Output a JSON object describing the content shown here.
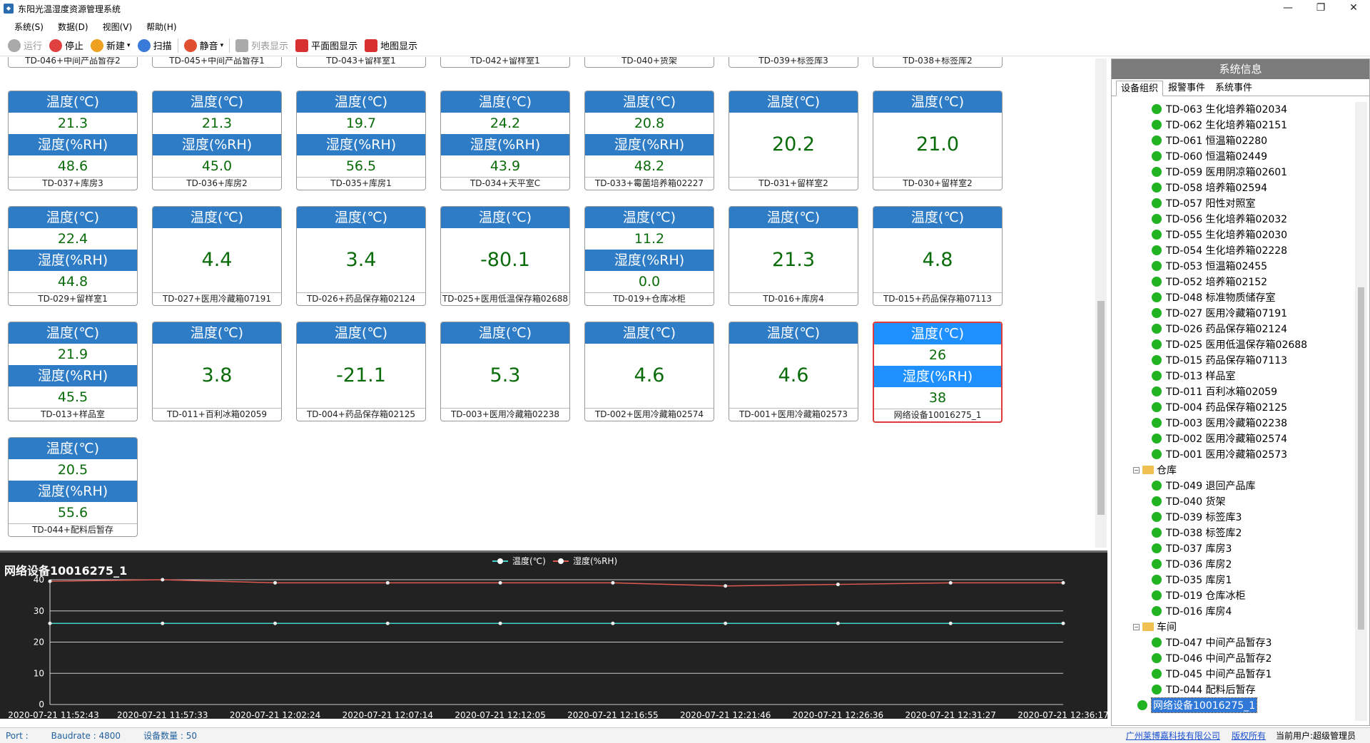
{
  "window": {
    "title": "东阳光温湿度资源管理系统",
    "min": "—",
    "max": "❐",
    "close": "✕"
  },
  "menu": [
    "系统(S)",
    "数据(D)",
    "视图(V)",
    "帮助(H)"
  ],
  "toolbar": [
    {
      "label": "运行",
      "icon": "play-icon",
      "color": "#aaaaaa",
      "disabled": true
    },
    {
      "label": "停止",
      "icon": "stop-icon",
      "color": "#e04040",
      "disabled": false
    },
    {
      "label": "新建",
      "icon": "add-icon",
      "color": "#f0a020",
      "disabled": false
    },
    {
      "label": "扫描",
      "icon": "scan-icon",
      "color": "#3a7ad8",
      "disabled": false
    },
    {
      "label": "静音",
      "icon": "alarm-icon",
      "color": "#e05030",
      "disabled": false
    },
    {
      "label": "列表显示",
      "icon": "list-icon",
      "color": "#aaaaaa",
      "disabled": true
    },
    {
      "label": "平面图显示",
      "icon": "pin-icon",
      "color": "#d83030",
      "disabled": false
    },
    {
      "label": "地图显示",
      "icon": "map-pin-icon",
      "color": "#d83030",
      "disabled": false
    }
  ],
  "cards": {
    "labels": {
      "temp": "温度(℃)",
      "hum": "湿度(%RH)"
    },
    "row0": [
      "TD-046+中间产品暂存2",
      "TD-045+中间产品暂存1",
      "TD-043+留样室1",
      "TD-042+留样室1",
      "TD-040+货架",
      "TD-039+标签库3",
      "TD-038+标签库2"
    ],
    "row1": [
      {
        "t": "21.3",
        "h": "48.6",
        "name": "TD-037+库房3"
      },
      {
        "t": "21.3",
        "h": "45.0",
        "name": "TD-036+库房2"
      },
      {
        "t": "19.7",
        "h": "56.5",
        "name": "TD-035+库房1"
      },
      {
        "t": "24.2",
        "h": "43.9",
        "name": "TD-034+天平室C"
      },
      {
        "t": "20.8",
        "h": "48.2",
        "name": "TD-033+霉菌培养箱02227"
      },
      {
        "t": "20.2",
        "name": "TD-031+留样室2"
      },
      {
        "t": "21.0",
        "name": "TD-030+留样室2"
      }
    ],
    "row2": [
      {
        "t": "22.4",
        "h": "44.8",
        "name": "TD-029+留样室1"
      },
      {
        "t": "4.4",
        "name": "TD-027+医用冷藏箱07191"
      },
      {
        "t": "3.4",
        "name": "TD-026+药品保存箱02124"
      },
      {
        "t": "-80.1",
        "name": "TD-025+医用低温保存箱02688"
      },
      {
        "t": "11.2",
        "h": "0.0",
        "name": "TD-019+仓库冰柜"
      },
      {
        "t": "21.3",
        "name": "TD-016+库房4"
      },
      {
        "t": "4.8",
        "name": "TD-015+药品保存箱07113"
      }
    ],
    "row3": [
      {
        "t": "21.9",
        "h": "45.5",
        "name": "TD-013+样品室"
      },
      {
        "t": "3.8",
        "name": "TD-011+百利冰箱02059"
      },
      {
        "t": "-21.1",
        "name": "TD-004+药品保存箱02125"
      },
      {
        "t": "5.3",
        "name": "TD-003+医用冷藏箱02238"
      },
      {
        "t": "4.6",
        "name": "TD-002+医用冷藏箱02574"
      },
      {
        "t": "4.6",
        "name": "TD-001+医用冷藏箱02573"
      },
      {
        "t": "26",
        "h": "38",
        "name": "网络设备10016275_1"
      }
    ],
    "row4": [
      {
        "t": "20.5",
        "h": "55.6",
        "name": "TD-044+配料后暂存"
      }
    ]
  },
  "chart_title": "网络设备10016275_1",
  "chart_data": {
    "type": "line",
    "legend_position": "top-center",
    "grid": true,
    "ylim": [
      0,
      40
    ],
    "yticks": [
      "0",
      "10",
      "20",
      "30",
      "40"
    ],
    "xtick_labels": [
      "2020-07-21 11:52:43",
      "2020-07-21 11:57:33",
      "2020-07-21 12:02:24",
      "2020-07-21 12:07:14",
      "2020-07-21 12:12:05",
      "2020-07-21 12:16:55",
      "2020-07-21 12:21:46",
      "2020-07-21 12:26:36",
      "2020-07-21 12:31:27",
      "2020-07-21 12:36:17"
    ],
    "series": [
      {
        "name": "温度(℃)",
        "color": "#3fd0c8",
        "values": [
          26,
          26,
          26,
          26,
          26,
          26,
          26,
          26,
          26,
          26
        ]
      },
      {
        "name": "湿度(%RH)",
        "color": "#e05a50",
        "values": [
          39.5,
          40,
          39,
          39,
          39,
          39,
          38,
          38.5,
          39,
          39
        ]
      }
    ]
  },
  "status": {
    "port": "Port :",
    "baud": "Baudrate : 4800",
    "count": "设备数量 : 50",
    "company": "广州莱博嘉科技有限公司",
    "rights": "版权所有",
    "user": "当前用户:超级管理员"
  },
  "right": {
    "title": "系统信息",
    "tabs": [
      "设备组织",
      "报警事件",
      "系统事件"
    ],
    "tree": [
      {
        "l": "TD-063 生化培养箱02034",
        "t": "dev"
      },
      {
        "l": "TD-062 生化培养箱02151",
        "t": "dev"
      },
      {
        "l": "TD-061 恒温箱02280",
        "t": "dev"
      },
      {
        "l": "TD-060 恒温箱02449",
        "t": "dev"
      },
      {
        "l": "TD-059 医用阴凉箱02601",
        "t": "dev"
      },
      {
        "l": "TD-058 培养箱02594",
        "t": "dev"
      },
      {
        "l": "TD-057 阳性对照室",
        "t": "dev"
      },
      {
        "l": "TD-056 生化培养箱02032",
        "t": "dev"
      },
      {
        "l": "TD-055 生化培养箱02030",
        "t": "dev"
      },
      {
        "l": "TD-054 生化培养箱02228",
        "t": "dev"
      },
      {
        "l": "TD-053 恒温箱02455",
        "t": "dev"
      },
      {
        "l": "TD-052 培养箱02152",
        "t": "dev"
      },
      {
        "l": "TD-048 标准物质储存室",
        "t": "dev"
      },
      {
        "l": "TD-027 医用冷藏箱07191",
        "t": "dev"
      },
      {
        "l": "TD-026 药品保存箱02124",
        "t": "dev"
      },
      {
        "l": "TD-025 医用低温保存箱02688",
        "t": "dev"
      },
      {
        "l": "TD-015 药品保存箱07113",
        "t": "dev"
      },
      {
        "l": "TD-013 样品室",
        "t": "dev"
      },
      {
        "l": "TD-011 百利冰箱02059",
        "t": "dev"
      },
      {
        "l": "TD-004 药品保存箱02125",
        "t": "dev"
      },
      {
        "l": "TD-003 医用冷藏箱02238",
        "t": "dev"
      },
      {
        "l": "TD-002 医用冷藏箱02574",
        "t": "dev"
      },
      {
        "l": "TD-001 医用冷藏箱02573",
        "t": "dev"
      },
      {
        "l": "仓库",
        "t": "folder"
      },
      {
        "l": "TD-049 退回产品库",
        "t": "dev"
      },
      {
        "l": "TD-040 货架",
        "t": "dev"
      },
      {
        "l": "TD-039 标签库3",
        "t": "dev"
      },
      {
        "l": "TD-038 标签库2",
        "t": "dev"
      },
      {
        "l": "TD-037 库房3",
        "t": "dev"
      },
      {
        "l": "TD-036 库房2",
        "t": "dev"
      },
      {
        "l": "TD-035 库房1",
        "t": "dev"
      },
      {
        "l": "TD-019 仓库冰柜",
        "t": "dev"
      },
      {
        "l": "TD-016 库房4",
        "t": "dev"
      },
      {
        "l": "车间",
        "t": "folder"
      },
      {
        "l": "TD-047 中间产品暂存3",
        "t": "dev"
      },
      {
        "l": "TD-046 中间产品暂存2",
        "t": "dev"
      },
      {
        "l": "TD-045 中间产品暂存1",
        "t": "dev"
      },
      {
        "l": "TD-044 配料后暂存",
        "t": "dev"
      },
      {
        "l": "网络设备10016275_1",
        "t": "sel"
      }
    ]
  }
}
